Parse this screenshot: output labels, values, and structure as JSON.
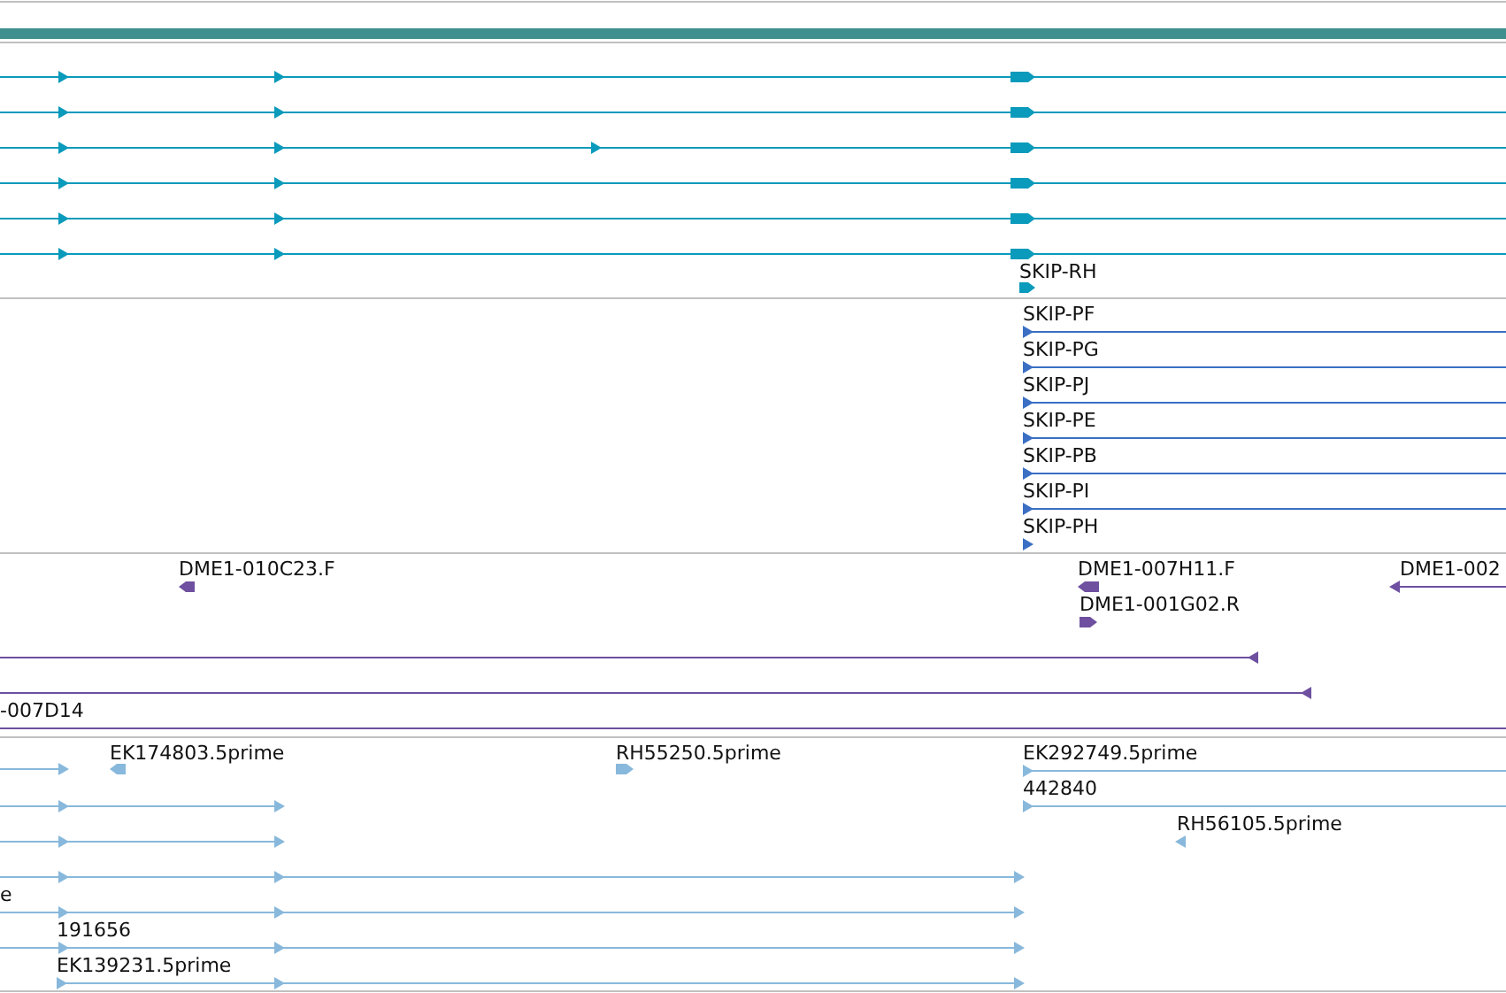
{
  "tracks": [
    {
      "color": "#0a9abb",
      "features": [
        {
          "reverse": false
        },
        {
          "reverse": false
        },
        {
          "reverse": false
        },
        {
          "reverse": false
        },
        {
          "reverse": false
        },
        {
          "reverse": false
        },
        {
          "label": "SKIP-RH",
          "reverse": false
        }
      ]
    },
    {
      "color": "#3a6fc4",
      "features": [
        {
          "label": "SKIP-PF",
          "reverse": false
        },
        {
          "label": "SKIP-PG",
          "reverse": false
        },
        {
          "label": "SKIP-PJ",
          "reverse": false
        },
        {
          "label": "SKIP-PE",
          "reverse": false
        },
        {
          "label": "SKIP-PB",
          "reverse": false
        },
        {
          "label": "SKIP-PI",
          "reverse": false
        },
        {
          "label": "SKIP-PH",
          "reverse": false
        }
      ]
    },
    {
      "color": "#6e4fa0",
      "features": [
        {
          "label": "DME1-010C23.F",
          "reverse": true
        },
        {
          "label": "DME1-007H11.F",
          "reverse": true
        },
        {
          "label": "DME1-002",
          "reverse": true
        },
        {
          "label": "DME1-001G02.R",
          "reverse": false
        },
        {
          "reverse": true
        },
        {
          "reverse": true
        },
        {
          "label": "-007D14"
        }
      ]
    },
    {
      "color": "#88b8dc",
      "features": [
        {
          "reverse": false
        },
        {
          "label": "EK174803.5prime",
          "reverse": true
        },
        {
          "label": "RH55250.5prime",
          "reverse": false
        },
        {
          "label": "EK292749.5prime",
          "reverse": false
        },
        {
          "reverse": false
        },
        {
          "label": "442840",
          "reverse": false
        },
        {
          "reverse": false
        },
        {
          "label": "RH56105.5prime",
          "reverse": true
        },
        {
          "reverse": false
        },
        {
          "label": "e",
          "reverse": false
        },
        {
          "label": "191656",
          "reverse": false
        },
        {
          "label": "EK139231.5prime",
          "reverse": false
        }
      ]
    }
  ]
}
